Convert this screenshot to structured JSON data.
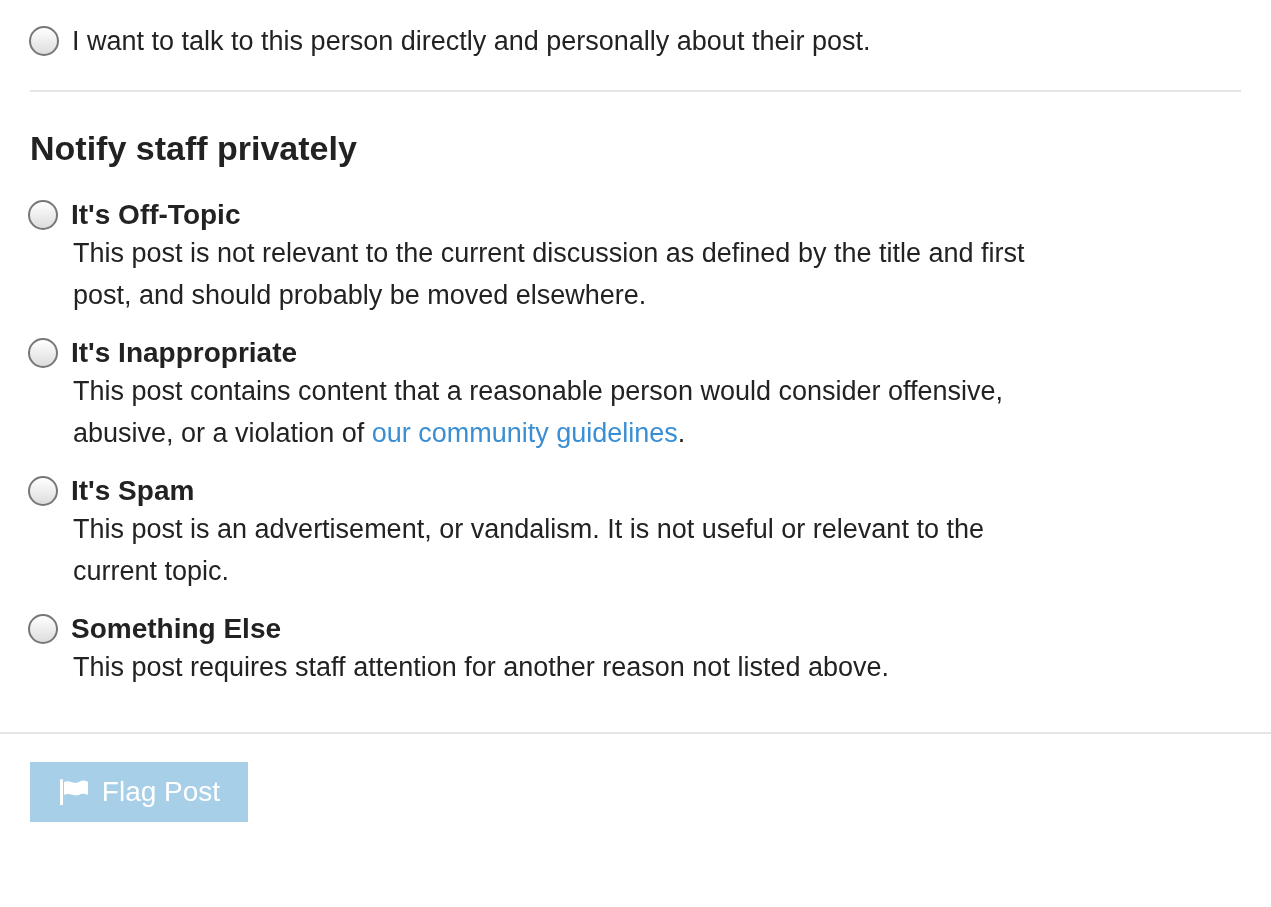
{
  "direct_option": {
    "label": "I want to talk to this person directly and personally about their post.",
    "selected": false
  },
  "section_title": "Notify staff privately",
  "options": [
    {
      "title": "It's Off-Topic",
      "description": "This post is not relevant to the current discussion as defined by the title and first post, and should probably be moved elsewhere.",
      "selected": false
    },
    {
      "title": "It's Inappropriate",
      "description": "This post contains content that a reasonable person would consider offensive, abusive, or a violation of ",
      "link": "our community guidelines",
      "description_end": ".",
      "selected": false
    },
    {
      "title": "It's Spam",
      "description": "This post is an advertisement, or vandalism. It is not useful or relevant to the current topic.",
      "selected": false
    },
    {
      "title": "Something Else",
      "description": "This post requires staff attention for another reason not listed above.",
      "selected": false
    }
  ],
  "button": {
    "label": "Flag Post",
    "disabled": true
  }
}
